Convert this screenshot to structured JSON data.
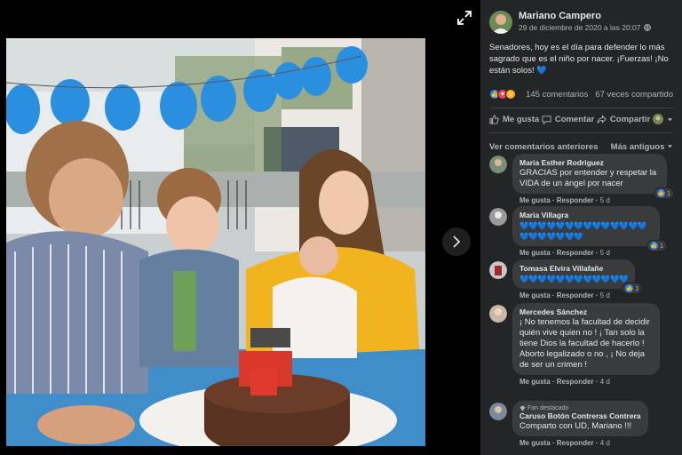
{
  "post": {
    "author": "Mariano Campero",
    "date": "29 de diciembre de 2020 a las 20:07",
    "text": "Senadores, hoy es el día para defender lo más sagrado que es el niño por nacer. ¡Fuerzas! ¡No están solos!",
    "text_heart": "💙"
  },
  "stats": {
    "comments": "145 comentarios",
    "shares": "67 veces compartido",
    "reactions": [
      "like-icon",
      "love-icon",
      "haha-icon"
    ]
  },
  "actions": {
    "like": "Me gusta",
    "comment": "Comentar",
    "share": "Compartir"
  },
  "comments_header": {
    "previous": "Ver comentarios anteriores",
    "sort": "Más antiguos"
  },
  "comments": [
    {
      "name": "Maria Esther Rodriguez",
      "text": "GRACIAS por entender y respetar la VIDA de un ángel por nacer",
      "like": "Me gusta",
      "reply": "Responder",
      "age": "5 d",
      "reactions": "1"
    },
    {
      "name": "Maria Villagra",
      "text": "💙💙💙💙💙💙💙💙💙💙💙💙💙💙💙💙💙💙💙💙💙",
      "like": "Me gusta",
      "reply": "Responder",
      "age": "5 d",
      "reactions": "1"
    },
    {
      "name": "Tomasa Elvira Villafañe",
      "text": "💙💙💙💙💙💙💙💙💙💙💙💙",
      "like": "Me gusta",
      "reply": "Responder",
      "age": "5 d",
      "reactions": "1"
    },
    {
      "name": "Mercedes Sánchez",
      "text": "¡ No tenemos la facultad de decidir quién vive quien no ! ¡ Tan solo la tiene Dios la facultad de hacerlo ! Aborto legalizado o no , ¡ No deja de ser un crimen !",
      "like": "Me gusta",
      "reply": "Responder",
      "age": "4 d"
    },
    {
      "badge": "Fan destacado",
      "name": "Caruso Botón Contreras Contrera",
      "text": "Comparto con UD, Mariano !!!",
      "like": "Me gusta",
      "reply": "Responder",
      "age": "4 d"
    }
  ],
  "colors": {
    "panel_bg": "#242526",
    "bubble_bg": "#3a3b3c",
    "accent": "#2d88ff",
    "heart": "#1da1f2"
  }
}
